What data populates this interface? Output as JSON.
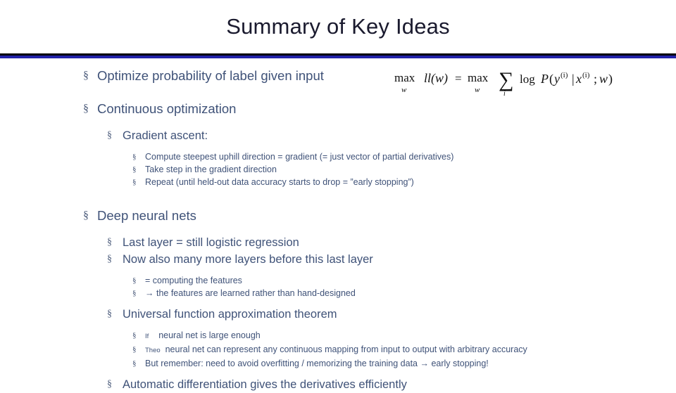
{
  "slide": {
    "title": "Summary of Key Ideas",
    "bullet_marker": "§",
    "formula": {
      "alt": "max over w of ll(w) = max over w of sum over i of log P(y^(i) | x^(i) ; w)",
      "parts": {
        "max1": "max",
        "sub1": "w",
        "ll": "ll(w) =",
        "max2": "max",
        "sub2": "w",
        "sigma": "∑",
        "sigma_sub": "i",
        "log": "log",
        "p": "P(y",
        "sup1": "(i)",
        "mid": "|x",
        "sup2": "(i)",
        "tail": "; w)"
      }
    },
    "content": [
      {
        "level": 1,
        "text": "Optimize probability of label given input"
      },
      {
        "level": 1,
        "text": "Continuous optimization"
      },
      {
        "level": 2,
        "text": "Gradient ascent:"
      },
      {
        "level": 3,
        "text": "Compute steepest uphill direction = gradient (= just vector of partial derivatives)"
      },
      {
        "level": 3,
        "text": "Take step in the gradient direction"
      },
      {
        "level": 3,
        "text": "Repeat (until held-out data accuracy starts to drop = ”early stopping”)"
      },
      {
        "level": 1,
        "text": "Deep neural nets"
      },
      {
        "level": 2,
        "text": "Last layer = still logistic regression"
      },
      {
        "level": 2,
        "text": "Now also many more layers before this last layer"
      },
      {
        "level": 3,
        "text": "= computing the features"
      },
      {
        "level": 3,
        "text": "→ the features are learned rather than hand-designed"
      },
      {
        "level": 2,
        "text": "Universal function approximation theorem"
      },
      {
        "level": 3,
        "text_small": "If",
        "text": "neural net is large enough"
      },
      {
        "level": 3,
        "text_small": "Theo",
        "text": "neural net can represent any continuous mapping from input to output with arbitrary accuracy"
      },
      {
        "level": 3,
        "text": "But remember: need to avoid overfitting  / memorizing the training data → early stopping!"
      },
      {
        "level": 2,
        "text": "Automatic differentiation gives the derivatives efficiently"
      }
    ]
  },
  "colors": {
    "title": "#1a1a2e",
    "rule_dark": "#000000",
    "rule_blue": "#2222a8",
    "body_text": "#3f5278"
  }
}
